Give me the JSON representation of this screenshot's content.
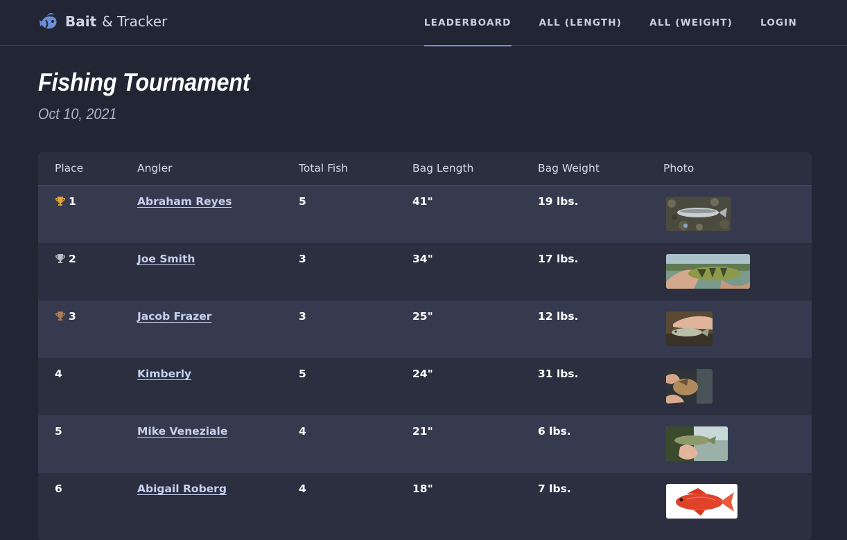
{
  "brand": {
    "strong": "Bait",
    "rest": "& Tracker"
  },
  "nav": [
    {
      "label": "LEADERBOARD",
      "active": true
    },
    {
      "label": "ALL (LENGTH)",
      "active": false
    },
    {
      "label": "ALL (WEIGHT)",
      "active": false
    },
    {
      "label": "LOGIN",
      "active": false
    }
  ],
  "page": {
    "title": "Fishing Tournament",
    "date": "Oct 10, 2021"
  },
  "table": {
    "headers": [
      "Place",
      "Angler",
      "Total Fish",
      "Bag Length",
      "Bag Weight",
      "Photo"
    ],
    "rows": [
      {
        "place": "1",
        "trophy": "gold-trophy-icon",
        "angler": "Abraham Reyes",
        "total_fish": "5",
        "bag_length": "41\"",
        "bag_weight": "19 lbs."
      },
      {
        "place": "2",
        "trophy": "silver-trophy-icon",
        "angler": "Joe Smith",
        "total_fish": "3",
        "bag_length": "34\"",
        "bag_weight": "17 lbs."
      },
      {
        "place": "3",
        "trophy": "bronze-trophy-icon",
        "angler": "Jacob Frazer",
        "total_fish": "3",
        "bag_length": "25\"",
        "bag_weight": "12 lbs."
      },
      {
        "place": "4",
        "trophy": "",
        "angler": "Kimberly",
        "total_fish": "5",
        "bag_length": "24\"",
        "bag_weight": "31 lbs."
      },
      {
        "place": "5",
        "trophy": "",
        "angler": "Mike Veneziale",
        "total_fish": "4",
        "bag_length": "21\"",
        "bag_weight": "6 lbs."
      },
      {
        "place": "6",
        "trophy": "",
        "angler": "Abigail Roberg",
        "total_fish": "4",
        "bag_length": "18\"",
        "bag_weight": "7 lbs."
      }
    ]
  },
  "colors": {
    "background": "#222634",
    "card": "#2b2f40",
    "row_alt": "#363a4e",
    "accent": "#7c8fd6",
    "gold": "#e0a33a",
    "silver": "#b9bcc4",
    "bronze": "#b07a52"
  }
}
